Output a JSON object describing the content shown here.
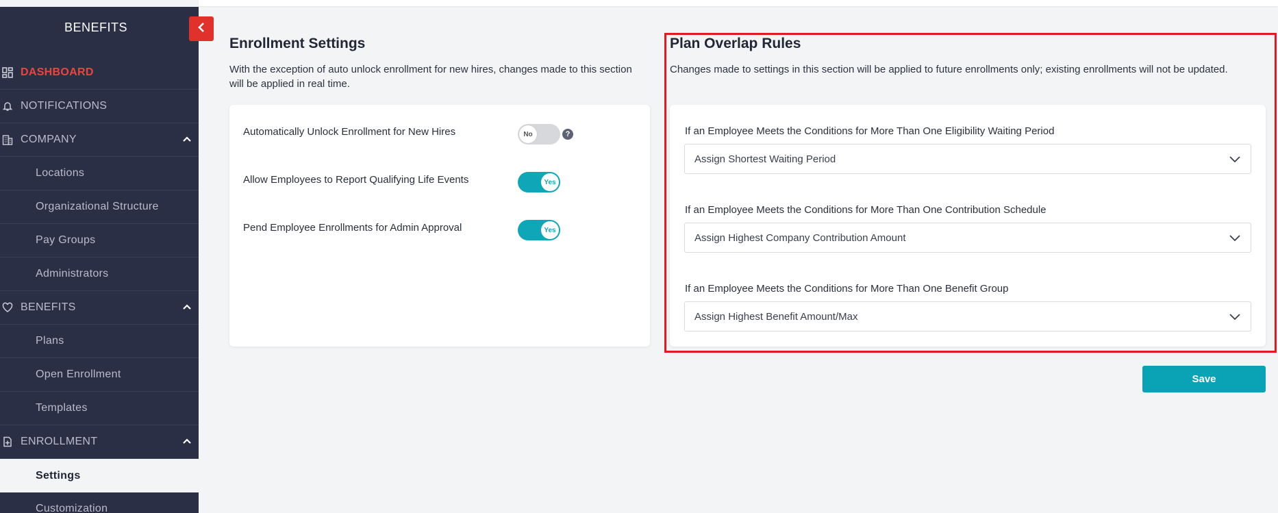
{
  "sidebar": {
    "title": "BENEFITS",
    "items": [
      {
        "label": "DASHBOARD",
        "type": "section",
        "icon": "dashboard-icon",
        "active": true
      },
      {
        "label": "NOTIFICATIONS",
        "type": "section",
        "icon": "bell-icon"
      },
      {
        "label": "COMPANY",
        "type": "section",
        "icon": "building-icon",
        "expanded": true
      },
      {
        "label": "Locations",
        "type": "sub"
      },
      {
        "label": "Organizational Structure",
        "type": "sub"
      },
      {
        "label": "Pay Groups",
        "type": "sub"
      },
      {
        "label": "Administrators",
        "type": "sub"
      },
      {
        "label": "BENEFITS",
        "type": "section",
        "icon": "heart-icon",
        "expanded": true
      },
      {
        "label": "Plans",
        "type": "sub"
      },
      {
        "label": "Open Enrollment",
        "type": "sub"
      },
      {
        "label": "Templates",
        "type": "sub"
      },
      {
        "label": "ENROLLMENT",
        "type": "section",
        "icon": "file-plus-icon",
        "expanded": true
      },
      {
        "label": "Settings",
        "type": "sub",
        "selected": true
      },
      {
        "label": "Customization",
        "type": "sub"
      }
    ]
  },
  "enrollment_settings": {
    "title": "Enrollment Settings",
    "description": "With the exception of auto unlock enrollment for new hires, changes made to this section will be applied in real time.",
    "settings": [
      {
        "label": "Automatically Unlock Enrollment for New Hires",
        "toggle": "No",
        "on": false,
        "help": "?"
      },
      {
        "label": "Allow Employees to Report Qualifying Life Events",
        "toggle": "Yes",
        "on": true
      },
      {
        "label": "Pend Employee Enrollments for Admin Approval",
        "toggle": "Yes",
        "on": true
      }
    ]
  },
  "plan_overlap": {
    "title": "Plan Overlap Rules",
    "description": "Changes made to settings in this section will be applied to future enrollments only; existing enrollments will not be updated.",
    "rules": [
      {
        "label": "If an Employee Meets the Conditions for More Than One Eligibility Waiting Period",
        "value": "Assign Shortest Waiting Period"
      },
      {
        "label": "If an Employee Meets the Conditions for More Than One Contribution Schedule",
        "value": "Assign Highest Company Contribution Amount"
      },
      {
        "label": "If an Employee Meets the Conditions for More Than One Benefit Group",
        "value": "Assign Highest Benefit Amount/Max"
      }
    ]
  },
  "actions": {
    "save_label": "Save"
  },
  "colors": {
    "sidebar": "#2b2f45",
    "accent": "#0aa3b5",
    "active": "#e8473c",
    "highlight": "#e21b23"
  }
}
